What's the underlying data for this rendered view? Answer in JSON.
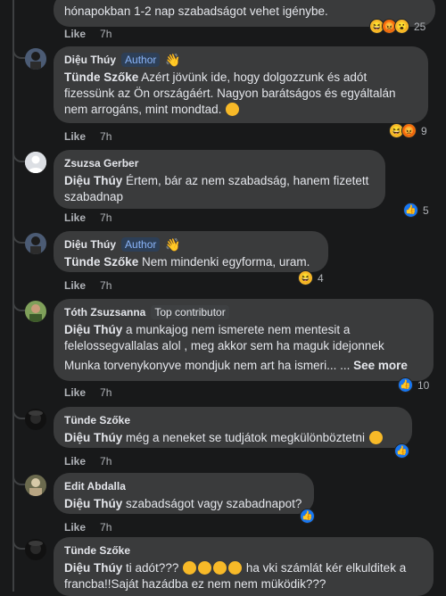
{
  "comments": [
    {
      "author": "",
      "badge": "",
      "text_line": "hónapokban 1-2 nap szabadságot vehet igénybe.",
      "like_label": "Like",
      "time": "7h",
      "reaction_count": "25"
    },
    {
      "author": "Diệu Thúy",
      "badge": "Author",
      "mention": "Tünde Szőke",
      "text": "Azért jövünk ide, hogy dolgozzunk és adót fizessünk az Ön országáért. Nagyon barátságos és egyáltalán nem arrogáns, mint mondtad.",
      "like_label": "Like",
      "time": "7h",
      "reaction_count": "9"
    },
    {
      "author": "Zsuzsa Gerber",
      "mention": "Diệu Thúy",
      "text": "Értem, bár az nem szabadság, hanem fizetett szabadnap",
      "like_label": "Like",
      "time": "7h",
      "reaction_count": "5"
    },
    {
      "author": "Diệu Thúy",
      "badge": "Author",
      "mention": "Tünde Szőke",
      "text": "Nem mindenki egyforma, uram.",
      "like_label": "Like",
      "time": "7h",
      "reaction_count": "4"
    },
    {
      "author": "Tóth Zsuzsanna",
      "badge": "Top contributor",
      "mention": "Diệu Thúy",
      "text": "a munkajog nem ismerete nem mentesit a felelossegvallalas alol , meg akkor sem ha maguk idejonnek",
      "text2": "Munka torvenykonyve mondjuk nem art ha ismeri... ...",
      "see_more": "See more",
      "like_label": "Like",
      "time": "7h",
      "reaction_count": "10"
    },
    {
      "author": "Tünde Szőke",
      "mention": "Diệu Thúy",
      "text": "még a neneket se tudjátok megkülönböztetni",
      "like_label": "Like",
      "time": "7h"
    },
    {
      "author": "Edit Abdalla",
      "mention": "Diệu Thúy",
      "text": "szabadságot vagy szabadnapot?",
      "like_label": "Like",
      "time": "7h"
    },
    {
      "author": "Tünde Szőke",
      "mention": "Diệu Thúy",
      "text_a": "ti adót???",
      "text_b": "ha vki számlát kér elkulditek a francba!!Saját hazádba ez nem nem müködik???"
    }
  ]
}
